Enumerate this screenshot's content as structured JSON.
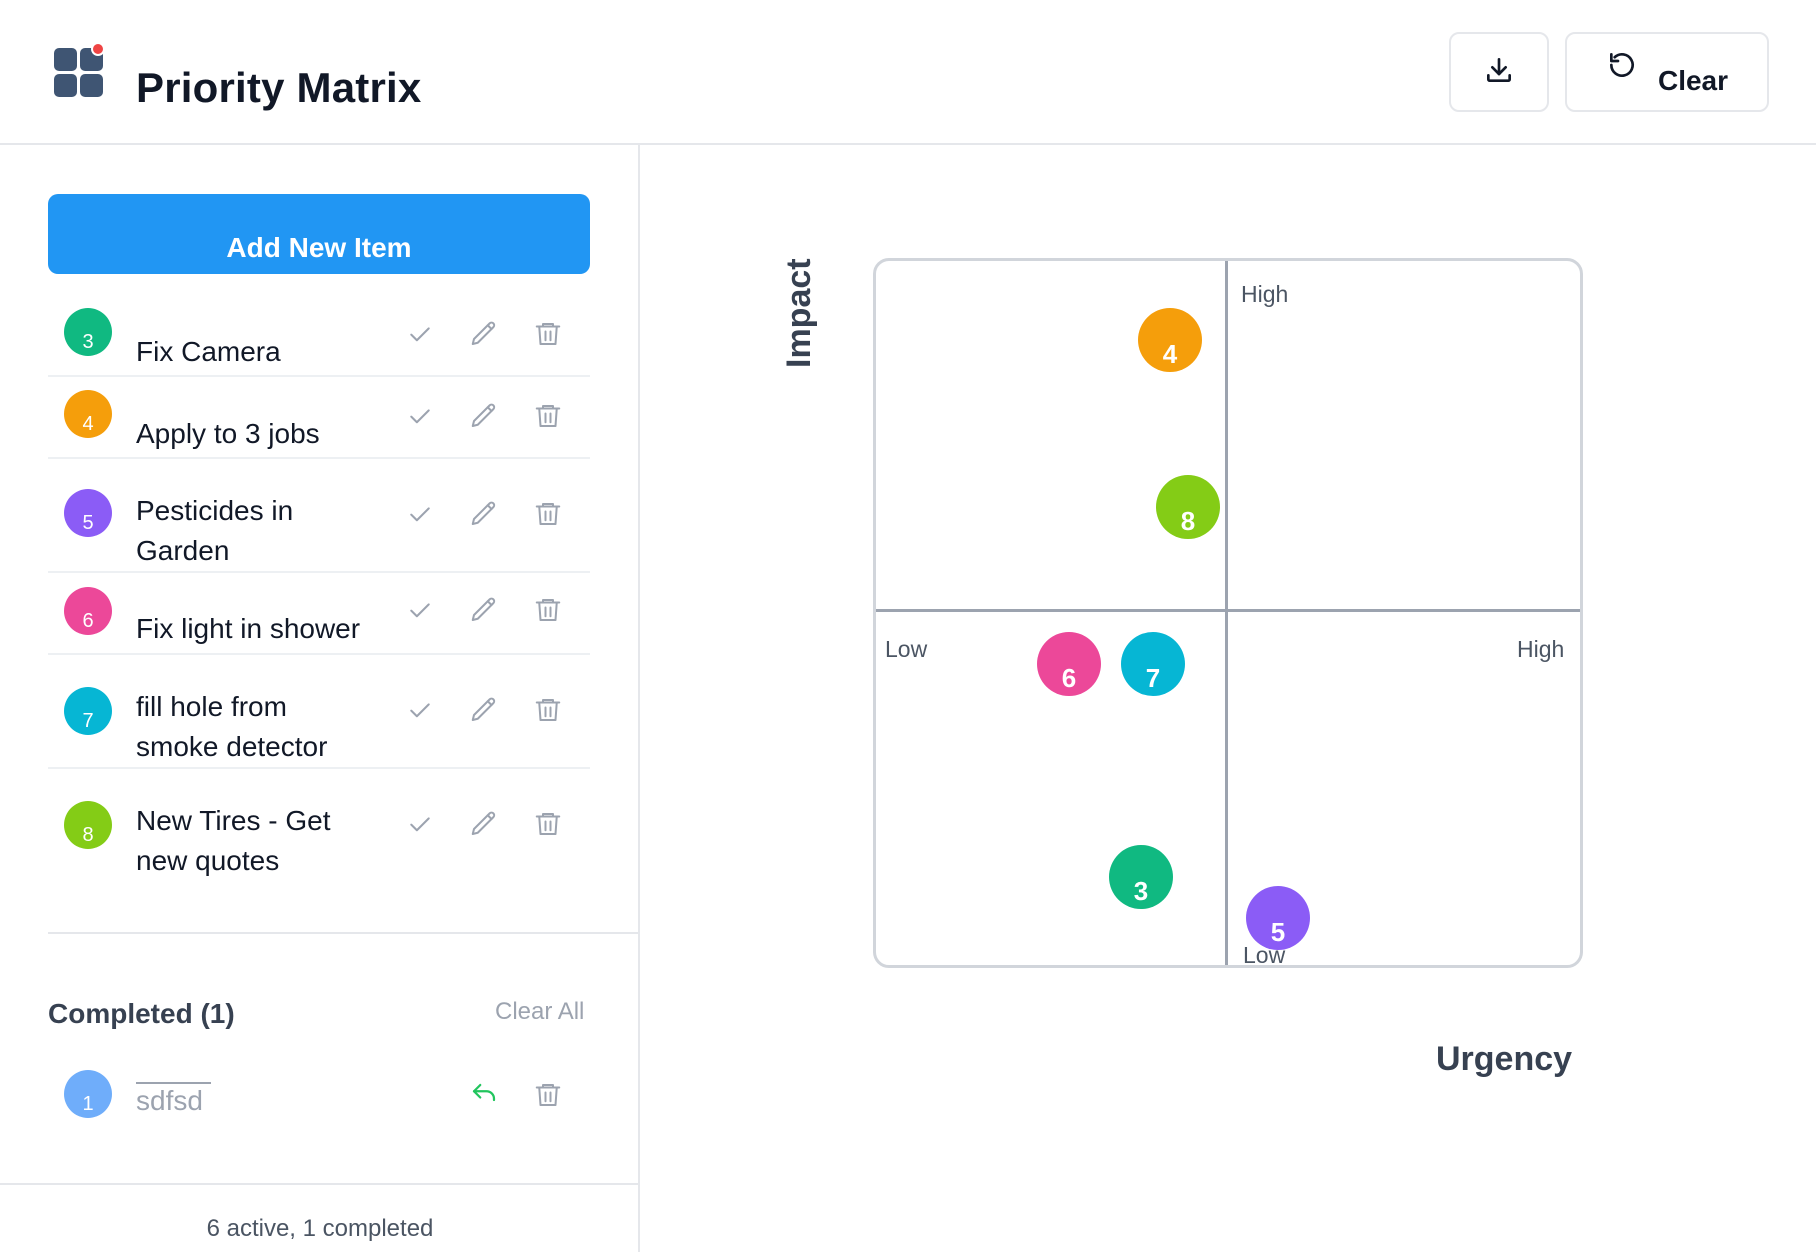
{
  "header": {
    "title": "Priority Matrix",
    "clear_label": "Clear",
    "download_icon": "download-icon",
    "clear_icon": "refresh-icon"
  },
  "sidebar": {
    "add_label": "Add New Item",
    "items": [
      {
        "num": "3",
        "label": "Fix Camera",
        "color": "#10b981"
      },
      {
        "num": "4",
        "label": "Apply to 3 jobs",
        "color": "#f59e0b"
      },
      {
        "num": "5",
        "label": "Pesticides in Garden",
        "color": "#8b5cf6"
      },
      {
        "num": "6",
        "label": "Fix light in shower",
        "color": "#ec4899"
      },
      {
        "num": "7",
        "label": "fill hole from smoke detector",
        "color": "#06b6d4"
      },
      {
        "num": "8",
        "label": "New Tires - Get new quotes",
        "color": "#84cc16"
      }
    ],
    "completed_title": "Completed (1)",
    "clear_all_label": "Clear All",
    "completed_items": [
      {
        "num": "1",
        "label": "sdfsd",
        "color": "#60a5fa"
      }
    ],
    "footer": "6 active, 1 completed"
  },
  "matrix": {
    "y_axis_label": "Impact",
    "x_axis_label": "Urgency",
    "high_top": "High",
    "low_bottom": "Low",
    "low_left": "Low",
    "high_right": "High",
    "points": [
      {
        "num": "4",
        "color": "#f59e0b"
      },
      {
        "num": "8",
        "color": "#84cc16"
      },
      {
        "num": "6",
        "color": "#ec4899"
      },
      {
        "num": "7",
        "color": "#06b6d4"
      },
      {
        "num": "3",
        "color": "#10b981"
      },
      {
        "num": "5",
        "color": "#8b5cf6"
      }
    ]
  }
}
